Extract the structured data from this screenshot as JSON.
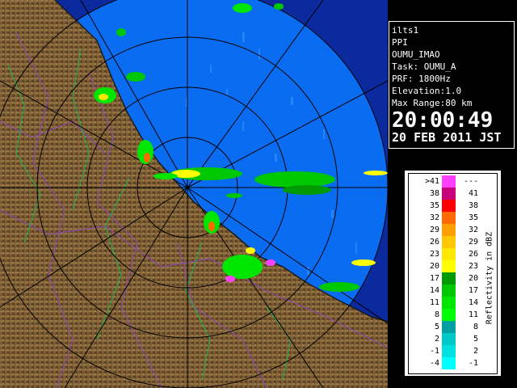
{
  "info": {
    "lines": [
      "ilts1",
      "PPI",
      "OUMU_IMAO",
      "Task: OUMU_A",
      "PRF: 1800Hz",
      "Elevation:1.0",
      "Max Range:80 km"
    ],
    "time": "20:00:49",
    "date": "20 FEB 2011 JST"
  },
  "scale": {
    "unit_label": "Reflectivity in dBZ",
    "rows": [
      {
        "low": ">41",
        "high": "---",
        "color": "#ff40ff"
      },
      {
        "low": "38",
        "high": "41",
        "color": "#c8007a"
      },
      {
        "low": "35",
        "high": "38",
        "color": "#ff0000"
      },
      {
        "low": "32",
        "high": "35",
        "color": "#ff6a00"
      },
      {
        "low": "29",
        "high": "32",
        "color": "#ff9f00"
      },
      {
        "low": "26",
        "high": "29",
        "color": "#ffc800"
      },
      {
        "low": "23",
        "high": "26",
        "color": "#ffe800"
      },
      {
        "low": "20",
        "high": "23",
        "color": "#ffff00"
      },
      {
        "low": "17",
        "high": "20",
        "color": "#009a00"
      },
      {
        "low": "14",
        "high": "17",
        "color": "#00c800"
      },
      {
        "low": "11",
        "high": "14",
        "color": "#00e600"
      },
      {
        "low": "8",
        "high": "11",
        "color": "#00ff00"
      },
      {
        "low": "5",
        "high": "8",
        "color": "#00a0a0"
      },
      {
        "low": "2",
        "high": "5",
        "color": "#00c8c8"
      },
      {
        "low": "-1",
        "high": "2",
        "color": "#00e0e0"
      },
      {
        "low": "-4",
        "high": "-1",
        "color": "#00ffff"
      }
    ]
  },
  "colors": {
    "sea": "#0a2a9e",
    "radar_field": "#0a6cf0",
    "land": "#7a5a30",
    "range_ring": "#000000",
    "border_line": "#8a4aa8"
  }
}
